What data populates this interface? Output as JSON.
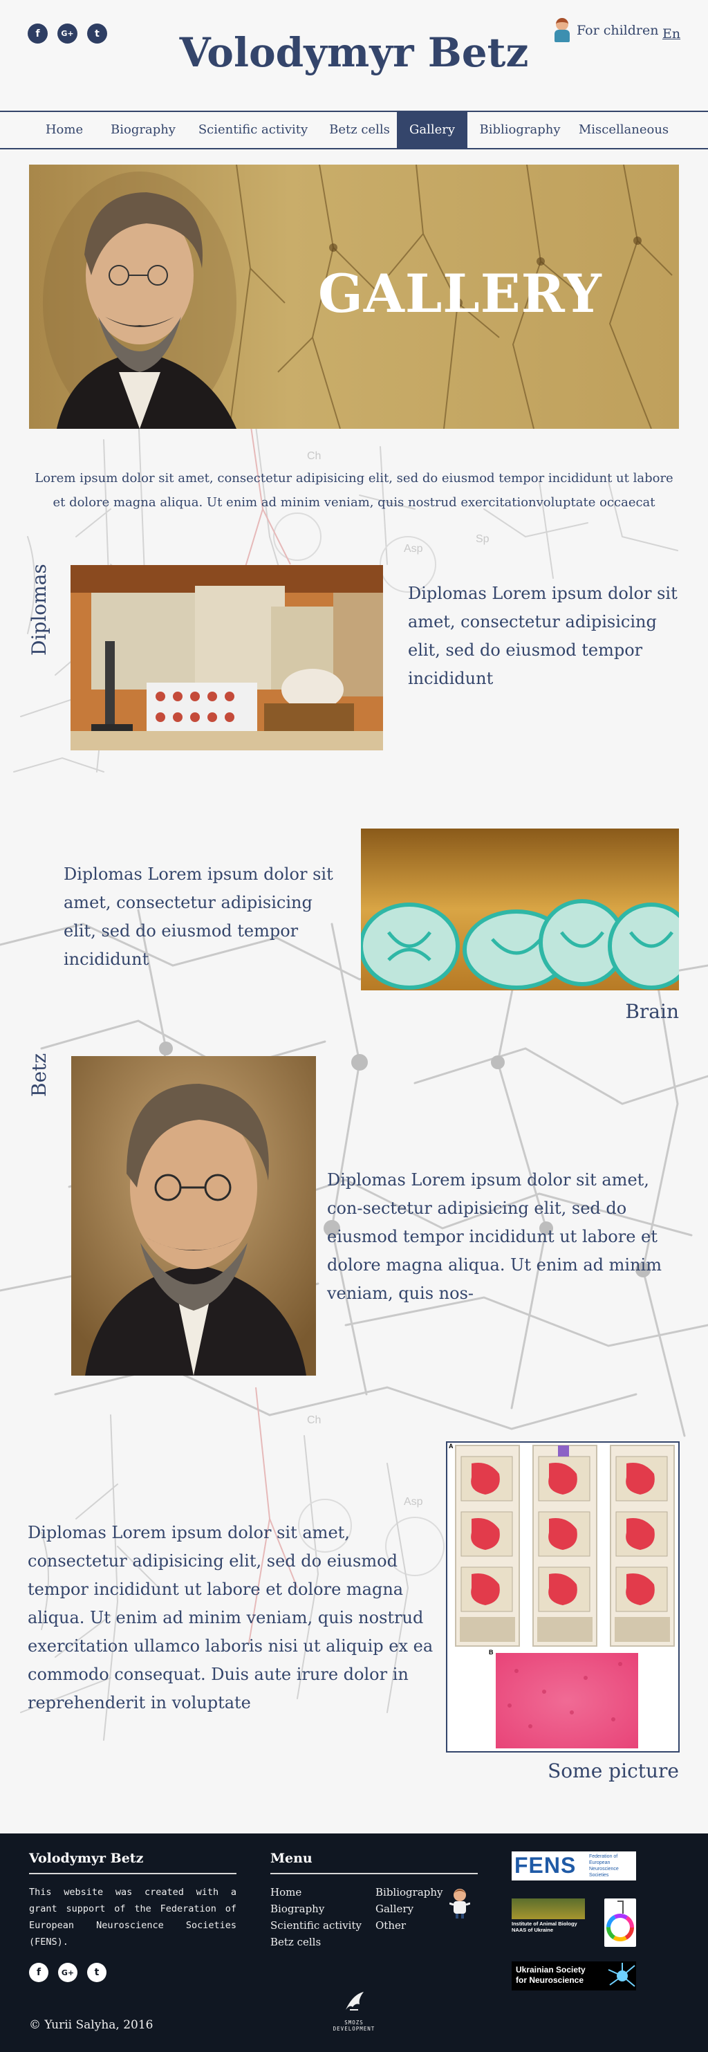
{
  "header": {
    "site_title": "Volodymyr Betz",
    "social": [
      {
        "icon": "facebook-icon",
        "glyph": "f"
      },
      {
        "icon": "google-plus-icon",
        "glyph": "G+"
      },
      {
        "icon": "twitter-icon",
        "glyph": "t"
      }
    ],
    "for_children": "For children",
    "language": "En"
  },
  "nav": {
    "items": [
      "Home",
      "Biography",
      "Scientific activity",
      "Betz cells",
      "Gallery",
      "Bibliography",
      "Miscellaneous"
    ],
    "active": "Gallery"
  },
  "hero": {
    "title": "GALLERY"
  },
  "intro": {
    "text": "Lorem ipsum dolor sit amet, consectetur adipisicing elit, sed do eiusmod tempor incididunt ut labore et dolore magna aliqua. Ut enim ad minim veniam, quis nostrud exercitationvoluptate occaecat"
  },
  "sections": {
    "diplomas": {
      "label": "Diplomas",
      "text": "Diplomas Lorem ipsum dolor sit amet, consectetur adipisicing elit, sed do eiusmod tempor incididunt"
    },
    "brain": {
      "text": "Diplomas Lorem ipsum dolor sit amet, consectetur adipisicing elit, sed do eiusmod tempor incididunt",
      "caption": "Brain"
    },
    "betz": {
      "label": "Betz",
      "text": "Diplomas Lorem ipsum dolor sit amet, con-sectetur adipisicing elit, sed do eiusmod tempor incididunt ut labore et dolore magna aliqua. Ut enim ad minim veniam, quis nos-"
    },
    "picture": {
      "text": "Diplomas Lorem ipsum dolor sit amet, consectetur adipisicing elit, sed do eiusmod tempor incididunt ut labore et dolore magna aliqua. Ut enim ad minim veniam, quis nostrud exercitation ullamco laboris nisi ut aliquip ex ea commodo consequat. Duis aute irure dolor in reprehenderit in voluptate",
      "caption": "Some picture",
      "panel_a": "A",
      "panel_b": "B"
    }
  },
  "footer": {
    "about_title": "Volodymyr Betz",
    "about_text": "This website was created with a grant support of the Federation of European Neuroscience Societies (FENS).",
    "menu_title": "Menu",
    "menu_col1": [
      "Home",
      "Biography",
      "Scientific activity",
      "Betz cells"
    ],
    "menu_col2": [
      "Bibliography",
      "Gallery",
      "Other"
    ],
    "copyright": "© Yurii Salyha, 2016",
    "developer": "SMOZS DEVELOPMENT",
    "logos": {
      "fens": "FENS",
      "fens_sub": "Federation of European Neuroscience Societies",
      "institute": "Institute of Animal Biology NAAS of Ukraine",
      "ukr_society": "Ukrainian Society for Neuroscience"
    }
  },
  "colors": {
    "primary": "#34456b",
    "footer_bg": "#101722",
    "hero_gold": "#c2a463"
  }
}
